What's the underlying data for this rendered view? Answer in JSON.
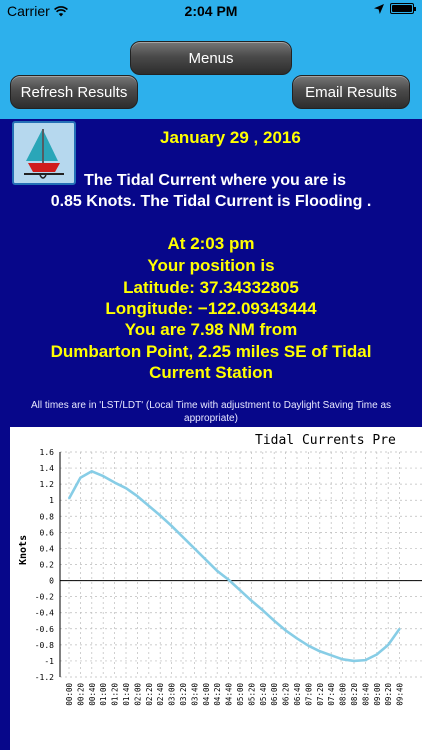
{
  "status_bar": {
    "carrier": "Carrier",
    "time": "2:04 PM"
  },
  "buttons": {
    "menus": "Menus",
    "refresh": "Refresh Results",
    "email": "Email Results"
  },
  "result": {
    "date": "January 29 , 2016",
    "current_line1": "The Tidal Current where you are is",
    "current_line2": "0.85 Knots. The Tidal Current is Flooding .",
    "at_time": "At 2:03 pm",
    "position_label": "Your position is",
    "latitude": "Latitude: 37.34332805",
    "longitude": "Longitude: −122.09343444",
    "distance": "You are 7.98 NM from",
    "station_line1": "Dumbarton Point, 2.25 miles SE of Tidal",
    "station_line2": "Current Station"
  },
  "note": "All times are in 'LST/LDT' (Local Time with adjustment to Daylight Saving Time as appropriate)",
  "colors": {
    "sky": "#2db0ec",
    "panel": "#07078a",
    "highlight": "#ffff00",
    "series": "#87cde6"
  },
  "chart_data": {
    "type": "line",
    "title": "Tidal Currents Pre",
    "ylabel": "Knots",
    "xlabel": "",
    "ylim": [
      -1.2,
      1.6
    ],
    "yticks": [
      "1.6",
      "1.4",
      "1.2",
      "1",
      "0.8",
      "0.6",
      "0.4",
      "0.2",
      "0",
      "-0.2",
      "-0.4",
      "-0.6",
      "-0.8",
      "-1",
      "-1.2"
    ],
    "xticks": [
      "00:00",
      "00:20",
      "00:40",
      "01:00",
      "01:20",
      "01:40",
      "02:00",
      "02:20",
      "02:40",
      "03:00",
      "03:20",
      "03:40",
      "04:00",
      "04:20",
      "04:40",
      "05:00",
      "05:20",
      "05:40",
      "06:00",
      "06:20",
      "06:40",
      "07:00",
      "07:20",
      "07:40",
      "08:00",
      "08:20",
      "08:40",
      "09:00",
      "09:20",
      "09:40"
    ],
    "grid": true,
    "series": [
      {
        "x": [
          "00:00",
          "00:20",
          "00:40",
          "01:00",
          "01:20",
          "01:40",
          "02:00",
          "02:20",
          "02:40",
          "03:00",
          "03:20",
          "03:40",
          "04:00",
          "04:20",
          "04:40",
          "05:00",
          "05:20",
          "05:40",
          "06:00",
          "06:20",
          "06:40",
          "07:00",
          "07:20",
          "07:40",
          "08:00",
          "08:20",
          "08:40",
          "09:00",
          "09:20",
          "09:40"
        ],
        "values": [
          1.02,
          1.28,
          1.36,
          1.3,
          1.22,
          1.15,
          1.05,
          0.93,
          0.81,
          0.68,
          0.54,
          0.4,
          0.26,
          0.12,
          0.01,
          -0.12,
          -0.25,
          -0.37,
          -0.5,
          -0.62,
          -0.72,
          -0.81,
          -0.88,
          -0.93,
          -0.98,
          -1.0,
          -0.99,
          -0.92,
          -0.8,
          -0.6
        ]
      }
    ]
  }
}
